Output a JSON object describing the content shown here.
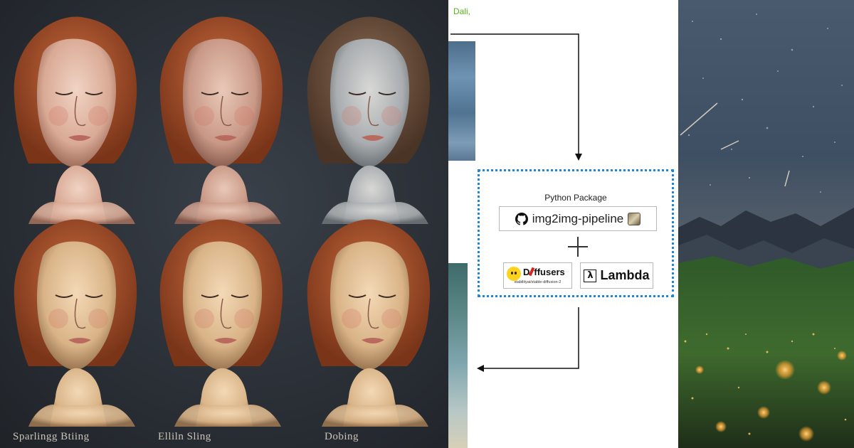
{
  "left_panel": {
    "captions": [
      "Sparlingg  Btiing",
      "Elliln Sling",
      "Dobing"
    ]
  },
  "diagram": {
    "top_text": "Dali,",
    "package_title": "Python Package",
    "repo_label": "img2img-pipeline",
    "repo_icon": "github-icon",
    "diffusers_label": "ffusers",
    "diffusers_prefix": "D",
    "diffusers_model": "stabilityai/stable-diffusion-2",
    "lambda_symbol": "λ",
    "lambda_label": "Lambda",
    "box_border_color": "#1f86d8"
  }
}
